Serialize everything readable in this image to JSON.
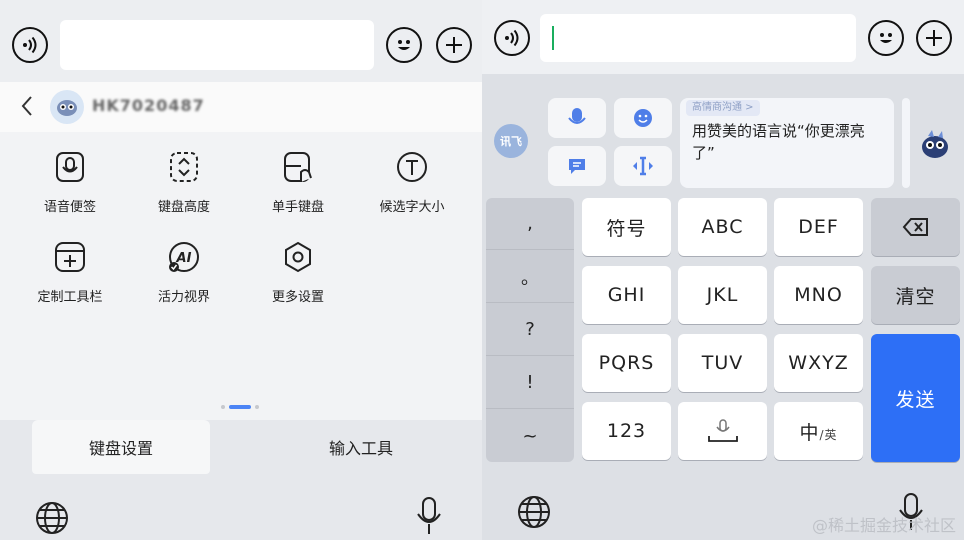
{
  "left": {
    "username": "HK7020487",
    "tools": [
      {
        "label": "语音便签",
        "icon": "voice-note-icon"
      },
      {
        "label": "键盘高度",
        "icon": "keyboard-height-icon"
      },
      {
        "label": "单手键盘",
        "icon": "one-hand-keyboard-icon"
      },
      {
        "label": "候选字大小",
        "icon": "candidate-size-icon"
      },
      {
        "label": "定制工具栏",
        "icon": "custom-toolbar-icon"
      },
      {
        "label": "活力视界",
        "icon": "ai-vision-icon"
      },
      {
        "label": "更多设置",
        "icon": "more-settings-icon"
      }
    ],
    "tabs": [
      {
        "label": "键盘设置",
        "selected": true
      },
      {
        "label": "输入工具",
        "selected": false
      }
    ]
  },
  "right": {
    "input_value": "",
    "logo_text": "讯飞",
    "card": {
      "tag": "高情商沟通 >",
      "text": "用赞美的语言说“你更漂亮了”"
    },
    "punctuation": [
      ",",
      "。",
      "?",
      "!",
      "~"
    ],
    "keys": {
      "symbols": "符号",
      "abc": "ABC",
      "def": "DEF",
      "ghi": "GHI",
      "jkl": "JKL",
      "mno": "MNO",
      "clear": "清空",
      "pqrs": "PQRS",
      "tuv": "TUV",
      "wxyz": "WXYZ",
      "send": "发送",
      "num": "123",
      "lang_main": "中",
      "lang_sub": "/英"
    },
    "watermark": "@稀土掘金技术社区"
  },
  "colors": {
    "accent": "#2d6ff6",
    "cursor": "#1aae5e"
  }
}
